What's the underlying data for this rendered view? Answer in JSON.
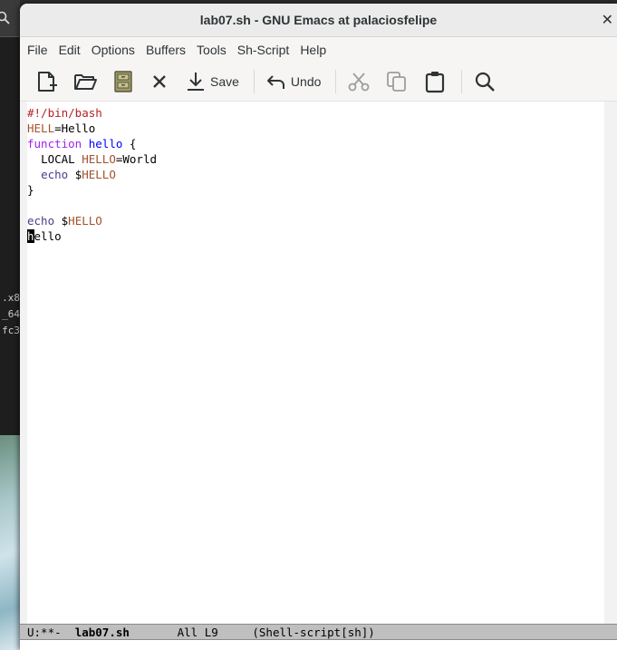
{
  "background": {
    "terminal_lines": [
      ".x8",
      "_64",
      "fc3"
    ]
  },
  "window": {
    "title": "lab07.sh - GNU Emacs at palaciosfelipe",
    "close_glyph": "✕"
  },
  "menubar": {
    "items": [
      "File",
      "Edit",
      "Options",
      "Buffers",
      "Tools",
      "Sh-Script",
      "Help"
    ]
  },
  "toolbar": {
    "save_label": "Save",
    "undo_label": "Undo"
  },
  "editor": {
    "lines": {
      "l1": "#!/bin/bash",
      "l2_var": "HELL",
      "l2_rest": "=Hello",
      "l3_kw": "function",
      "l3_fn": "hello",
      "l3_rest": " {",
      "l4_indent": "  ",
      "l4_local": "LOCAL ",
      "l4_var": "HELLO",
      "l4_rest": "=World",
      "l5_indent": "  ",
      "l5_builtin": "echo",
      "l5_rest": " $",
      "l5_var": "HELLO",
      "l6": "}",
      "l7": "",
      "l8_builtin": "echo",
      "l8_rest": " $",
      "l8_var": "HELLO",
      "l9_cursor_char": "h",
      "l9_rest": "ello"
    }
  },
  "modeline": {
    "status": "U:**-  ",
    "buffer": "lab07.sh",
    "position": "       All L9     ",
    "mode": "(Shell-script[sh])"
  },
  "colors": {
    "comment": "#b22222",
    "variable": "#a0522d",
    "keyword": "#a020f0",
    "function": "#0000ff",
    "builtin": "#483d8b"
  }
}
